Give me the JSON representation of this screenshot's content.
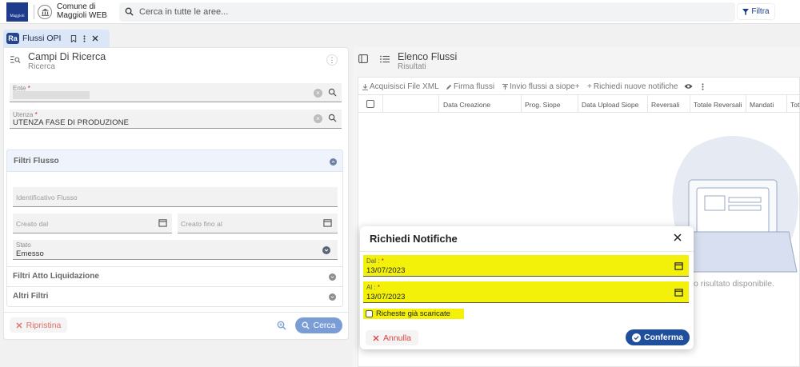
{
  "header": {
    "logo_text": "Maggioli",
    "municipality_name": "Comune di Maggioli WEB",
    "search_placeholder": "Cerca in tutte le aree...",
    "filter_label": "Filtra"
  },
  "tab": {
    "badge": "Ra",
    "label": "Flussi OPI"
  },
  "left_panel": {
    "title": "Campi Di Ricerca",
    "subtitle": "Ricerca",
    "ente_label": "Ente",
    "utenza_label": "Utenza",
    "utenza_value": "UTENZA FASE DI PRODUZIONE",
    "required_mark": "*",
    "filtri_flusso_label": "Filtri Flusso",
    "identificativo_placeholder": "Identificativo Flusso",
    "creato_dal_placeholder": "Creato dal",
    "creato_fino_placeholder": "Creato fino al",
    "stato_label": "Stato",
    "stato_value": "Emesso",
    "filtri_atto_label": "Filtri Atto Liquidazione",
    "altri_filtri_label": "Altri Filtri",
    "reset_label": "Ripristina",
    "search_label": "Cerca"
  },
  "right_panel": {
    "title": "Elenco Flussi",
    "subtitle": "Risultati",
    "toolbar": [
      "Acquisisci File XML",
      "Firma flussi",
      "Invio flussi a siope+",
      "Richiedi nuove notifiche"
    ],
    "columns": [
      "Data Creazione",
      "Prog. Siope",
      "Data Upload Siope",
      "Reversali",
      "Totale Reversali",
      "Mandati",
      "Tot"
    ],
    "no_result": "o risultato disponibile."
  },
  "modal": {
    "title": "Richiedi Notifiche",
    "dal_label": "Dal :",
    "dal_value": "13/07/2023",
    "al_label": "Al :",
    "al_value": "13/07/2023",
    "required_mark": "*",
    "checkbox_label": "Richeste già scaricate",
    "cancel_label": "Annulla",
    "confirm_label": "Conferma"
  },
  "colors": {
    "primary": "#1f4e9c",
    "highlight": "#f3f10a",
    "danger": "#d0241b",
    "tab_bg": "#dbe6f8"
  }
}
